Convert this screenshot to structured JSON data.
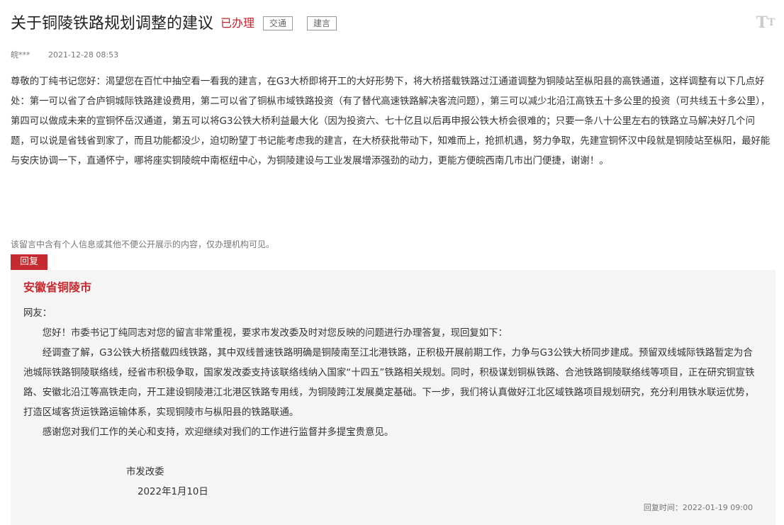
{
  "header": {
    "title": "关于铜陵铁路规划调整的建议",
    "status": "已办理",
    "tags": [
      "交通",
      "建言"
    ],
    "font_toggle_label_large": "T",
    "font_toggle_label_small": "T",
    "font_toggle_icon": "text-size-icon"
  },
  "meta": {
    "author": "皖***",
    "time": "2021-12-28 08:53"
  },
  "message": {
    "content": "尊敬的丁纯书记您好：渴望您在百忙中抽空看一看我的建言，在G3大桥即将开工的大好形势下，将大桥搭载铁路过江通道调整为铜陵站至枞阳县的高铁通道，这样调整有以下几点好处：第一可以省了合庐铜城际铁路建设费用，第二可以省了铜枞市域铁路投资（有了替代高速铁路解决客流问题），第三可以减少北沿江高铁五十多公里的投资（可共线五十多公里），第四可以做成未来的宣铜怀岳汉通道，第五可以将G3公铁大桥利益最大化（因为投资六、七十亿且以后再申报公铁大桥会很难的；只要一条八十公里左右的铁路立马解决好几个问题，可以说是省钱省到家了，而且功能都没少，迫切盼望丁书记能考虑我的建言，在大桥获批带动下，知难而上，抢抓机遇，努力争取，先建宣铜怀汉中段就是铜陵站至枞阳，最好能与安庆协调一下，直通怀宁，哪将座实铜陵皖中南枢纽中心，为铜陵建设与工业发展增添强劲的动力，更能方便皖西南几市出门便捷，谢谢！。",
    "privacy_notice": "该留言中含有个人信息或其他不便公开展示的内容，仅办理机构可见。"
  },
  "reply": {
    "tab_label": "回复",
    "organization": "安徽省铜陵市",
    "greeting": "网友：",
    "paragraphs": [
      "您好！市委书记丁纯同志对您的留言非常重视，要求市发改委及时对您反映的问题进行办理答复，现回复如下：",
      "经调查了解，G3公铁大桥搭载四线铁路，其中双线普速铁路明确是铜陵南至江北港铁路，正积极开展前期工作，力争与G3公铁大桥同步建成。预留双线城际铁路暂定为合池城际铁路铜陵联络线，经省市积极争取，国家发改委支持该联络线纳入国家“十四五”铁路相关规划。同时，积极谋划铜枞铁路、合池铁路铜陵联络线等项目，正在研究铜宣铁路、安徽北沿江等高铁走向，开工建设铜陵港江北港区铁路专用线，为铜陵跨江发展奠定基础。下一步，我们将认真做好江北区域铁路项目规划研究，充分利用铁水联运优势，打造区域客货运铁路运输体系，实现铜陵市与枞阳县的铁路联通。",
      "感谢您对我们工作的关心和支持，欢迎继续对我们的工作进行监督并多提宝贵意见。"
    ],
    "signer": "市发改委",
    "sign_date": "2022年1月10日",
    "reply_time": "回复时间：2022-01-19 09:00"
  },
  "colors": {
    "accent_red": "#c42a2f",
    "status_red": "#d0202a",
    "panel_bg": "#f5f5f5"
  }
}
